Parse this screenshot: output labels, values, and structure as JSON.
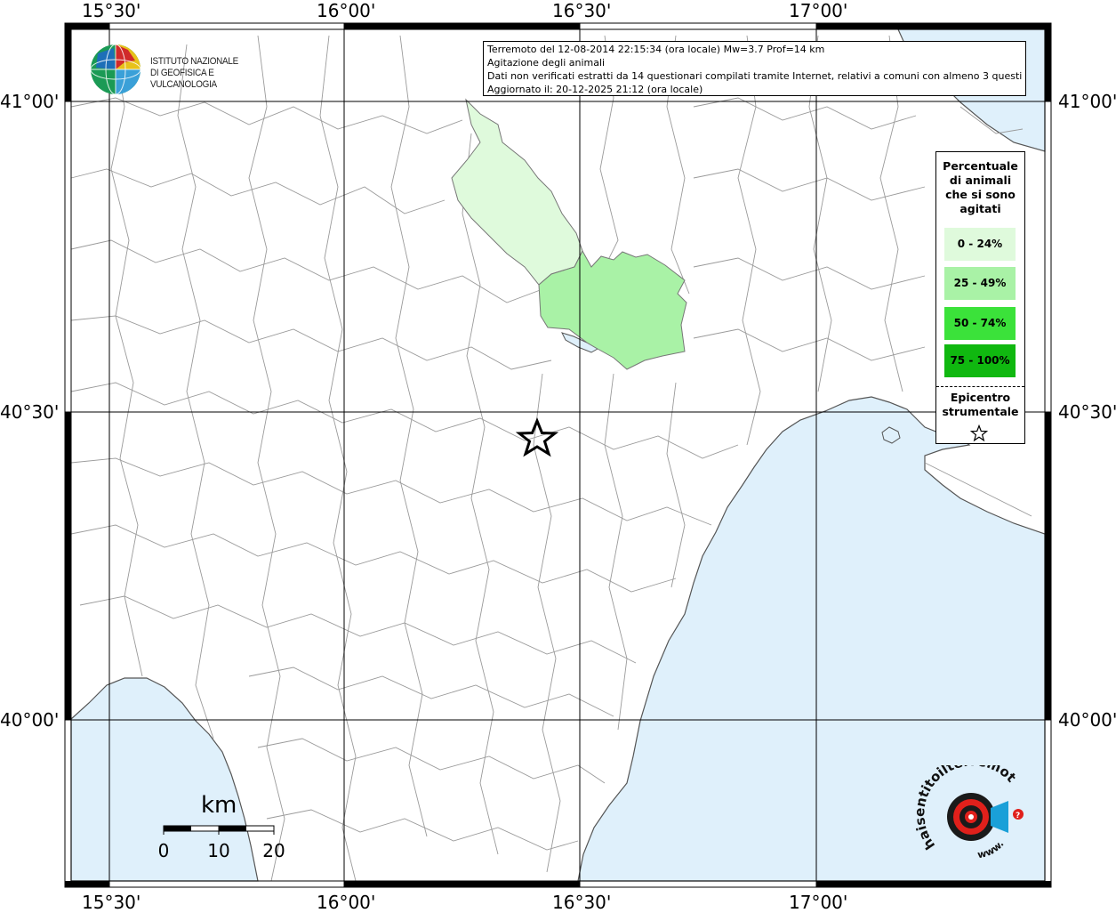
{
  "info": {
    "line1": "Terremoto del 12-08-2014 22:15:34 (ora locale) Mw=3.7 Prof=14 km",
    "line2": "Agitazione degli animali",
    "line3": "Dati non verificati estratti da 14 questionari compilati tramite Internet, relativi a comuni con almeno 3 questionari.",
    "line4": "Aggiornato il: 20-12-2025 21:12 (ora locale)"
  },
  "logo": {
    "line1": "ISTITUTO NAZIONALE",
    "line2": "DI GEOFISICA E VULCANOLOGIA"
  },
  "axes": {
    "lon_top": [
      "15°30'",
      "16°00'",
      "16°30'",
      "17°00'"
    ],
    "lon_bottom": [
      "15°30'",
      "16°00'",
      "16°30'",
      "17°00'"
    ],
    "lat_left": [
      "41°00'",
      "40°30'",
      "40°00'"
    ],
    "lat_right": [
      "41°00'",
      "40°30'",
      "40°00'"
    ]
  },
  "legend": {
    "title": [
      "Percentuale",
      "di animali",
      "che si sono",
      "agitati"
    ],
    "classes": [
      {
        "label": "0 - 24%",
        "color": "#dffadc"
      },
      {
        "label": "25 - 49%",
        "color": "#a9f2a6"
      },
      {
        "label": "50 - 74%",
        "color": "#3be23a"
      },
      {
        "label": "75 - 100%",
        "color": "#10b810"
      }
    ],
    "epicenter_title": [
      "Epicentro",
      "strumentale"
    ]
  },
  "scale": {
    "unit": "km",
    "ticks": [
      "0",
      "10",
      "20"
    ]
  },
  "brand": {
    "text_main": "haisentitoilterremoto.it",
    "text_www": "www."
  },
  "colors": {
    "sea": "#dff0fb",
    "grid": "#000000",
    "border_lines": "#9a9a9a",
    "zone_light": "#dffadc",
    "zone_medium": "#a9f2a6"
  }
}
